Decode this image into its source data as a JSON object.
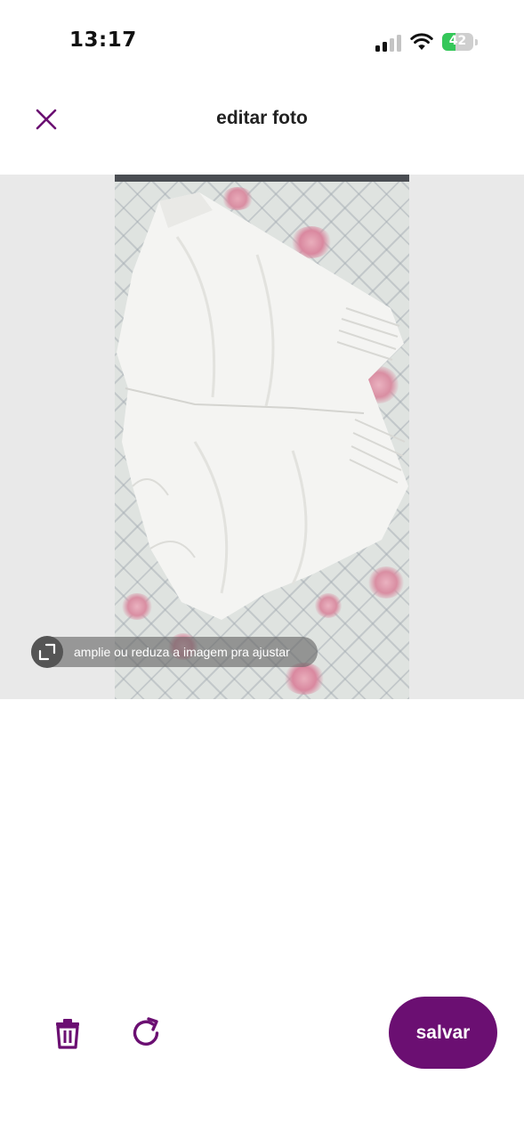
{
  "status_bar": {
    "time": "13:17",
    "battery_level": "42",
    "battery_percent": 0.42,
    "icons": [
      "signal-icon",
      "wifi-icon",
      "battery-icon"
    ]
  },
  "header": {
    "title": "editar foto",
    "close_icon": "close-icon"
  },
  "editor": {
    "hint_text": "amplie ou reduza a imagem pra ajustar",
    "hint_icon": "resize-icon"
  },
  "toolbar": {
    "delete_icon": "trash-icon",
    "rotate_icon": "rotate-icon",
    "save_label": "salvar"
  },
  "colors": {
    "accent": "#6b0f72",
    "canvas_bg": "#e9e9e9",
    "battery_green": "#34c759"
  }
}
